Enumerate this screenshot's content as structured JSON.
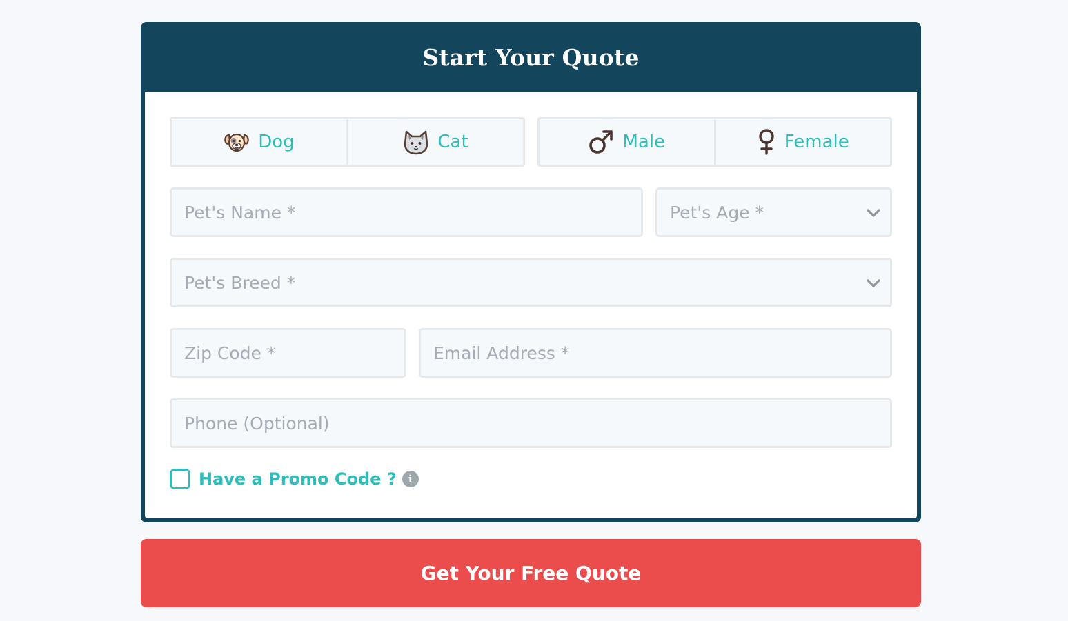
{
  "form": {
    "title": "Start Your Quote",
    "species": [
      {
        "label": "Dog",
        "icon": "dog-icon"
      },
      {
        "label": "Cat",
        "icon": "cat-icon"
      }
    ],
    "gender": [
      {
        "label": "Male",
        "icon": "male-symbol-icon"
      },
      {
        "label": "Female",
        "icon": "female-symbol-icon"
      }
    ],
    "pet_name": {
      "placeholder": "Pet's Name *",
      "value": ""
    },
    "pet_age": {
      "selected": "Pet's Age *"
    },
    "pet_breed": {
      "selected": "Pet's Breed *"
    },
    "zip_code": {
      "placeholder": "Zip Code *",
      "value": ""
    },
    "email": {
      "placeholder": "Email Address *",
      "value": ""
    },
    "phone": {
      "placeholder": "Phone (Optional)",
      "value": ""
    },
    "promo": {
      "label": "Have a Promo Code ?",
      "checked": false,
      "info_glyph": "i"
    },
    "submit_label": "Get Your Free Quote"
  },
  "colors": {
    "header_bg": "#13465c",
    "accent_teal": "#2ebdb8",
    "cta_red": "#eb4d4c",
    "field_border": "#e6e9ec",
    "placeholder": "#a4adb6"
  }
}
